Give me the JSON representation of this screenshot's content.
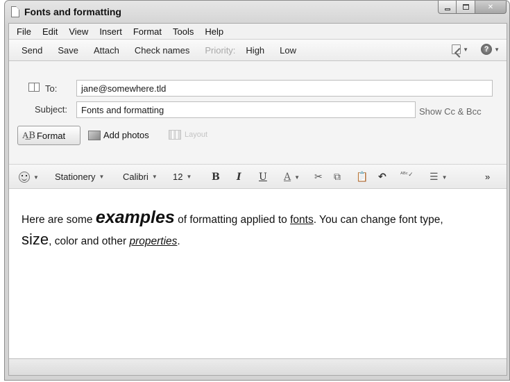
{
  "window": {
    "title": "Fonts and formatting"
  },
  "menu": [
    "File",
    "Edit",
    "View",
    "Insert",
    "Format",
    "Tools",
    "Help"
  ],
  "toolbar": {
    "send": "Send",
    "save": "Save",
    "attach": "Attach",
    "check_names": "Check names",
    "priority_label": "Priority:",
    "priority_high": "High",
    "priority_low": "Low",
    "right_icons": [
      "encoding-icon",
      "help-icon"
    ]
  },
  "header": {
    "to_label": "To:",
    "to_value": "jane@somewhere.tld",
    "subject_label": "Subject:",
    "subject_value": "Fonts and formatting",
    "show_cc_bcc": "Show Cc & Bcc",
    "format_button": "Format",
    "format_icon_text": "A͟B",
    "add_photos": "Add photos",
    "layout": "Layout"
  },
  "format_toolbar": {
    "emoticon_icon": "emoticon-icon",
    "stationery": "Stationery",
    "font_name": "Calibri",
    "font_size": "12",
    "bold": "B",
    "italic": "I",
    "underline": "U",
    "font_color": "A",
    "more": "»"
  },
  "body": {
    "part1": "Here are some ",
    "examples": "examples",
    "part2": " of formatting applied to ",
    "fonts": "fonts",
    "part3": ". You can change font type,",
    "size": "size",
    "part4": ", color and other ",
    "properties": "properties",
    "part5": "."
  },
  "colors": {
    "chrome": "#d3d3d3",
    "toolbar": "#f0f0f0",
    "disabled_text": "#a8a8a8"
  }
}
